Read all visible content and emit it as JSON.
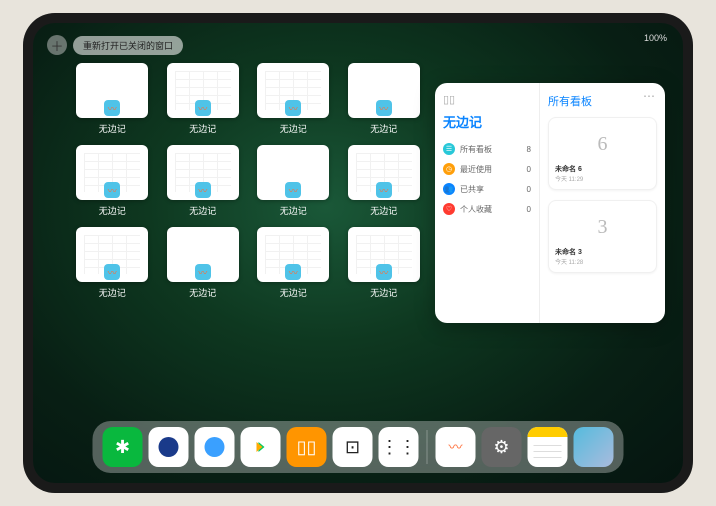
{
  "status": {
    "time": "",
    "battery": "100%"
  },
  "topbar": {
    "reopen_label": "重新打开已关闭的窗口"
  },
  "thumbs": [
    {
      "label": "无边记",
      "variant": "blank"
    },
    {
      "label": "无边记",
      "variant": "grid"
    },
    {
      "label": "无边记",
      "variant": "grid"
    },
    {
      "label": "无边记",
      "variant": "blank"
    },
    {
      "label": "无边记",
      "variant": "grid"
    },
    {
      "label": "无边记",
      "variant": "grid"
    },
    {
      "label": "无边记",
      "variant": "blank"
    },
    {
      "label": "无边记",
      "variant": "grid"
    },
    {
      "label": "无边记",
      "variant": "grid"
    },
    {
      "label": "无边记",
      "variant": "blank"
    },
    {
      "label": "无边记",
      "variant": "grid"
    },
    {
      "label": "无边记",
      "variant": "grid"
    }
  ],
  "panel": {
    "left_title": "无边记",
    "items": [
      {
        "icon": "all",
        "label": "所有看板",
        "count": 8
      },
      {
        "icon": "recent",
        "label": "最近使用",
        "count": 0
      },
      {
        "icon": "shared",
        "label": "已共享",
        "count": 0
      },
      {
        "icon": "fav",
        "label": "个人收藏",
        "count": 0
      }
    ],
    "right_title": "所有看板",
    "boards": [
      {
        "sketch": "6",
        "name": "未命名 6",
        "date": "今天 11:29"
      },
      {
        "sketch": "3",
        "name": "未命名 3",
        "date": "今天 11:28"
      }
    ]
  },
  "dock": {
    "apps": [
      {
        "id": "wechat",
        "name": "微信"
      },
      {
        "id": "blue1",
        "name": "app-2"
      },
      {
        "id": "blue2",
        "name": "app-3"
      },
      {
        "id": "play",
        "name": "play-store"
      },
      {
        "id": "books",
        "name": "图书"
      },
      {
        "id": "dice",
        "name": "app-6"
      },
      {
        "id": "nodes",
        "name": "app-7"
      }
    ],
    "recent": [
      {
        "id": "freeform",
        "name": "无边记"
      },
      {
        "id": "settings",
        "name": "设置"
      },
      {
        "id": "notes",
        "name": "备忘录"
      },
      {
        "id": "folder",
        "name": "app-folder"
      }
    ]
  }
}
